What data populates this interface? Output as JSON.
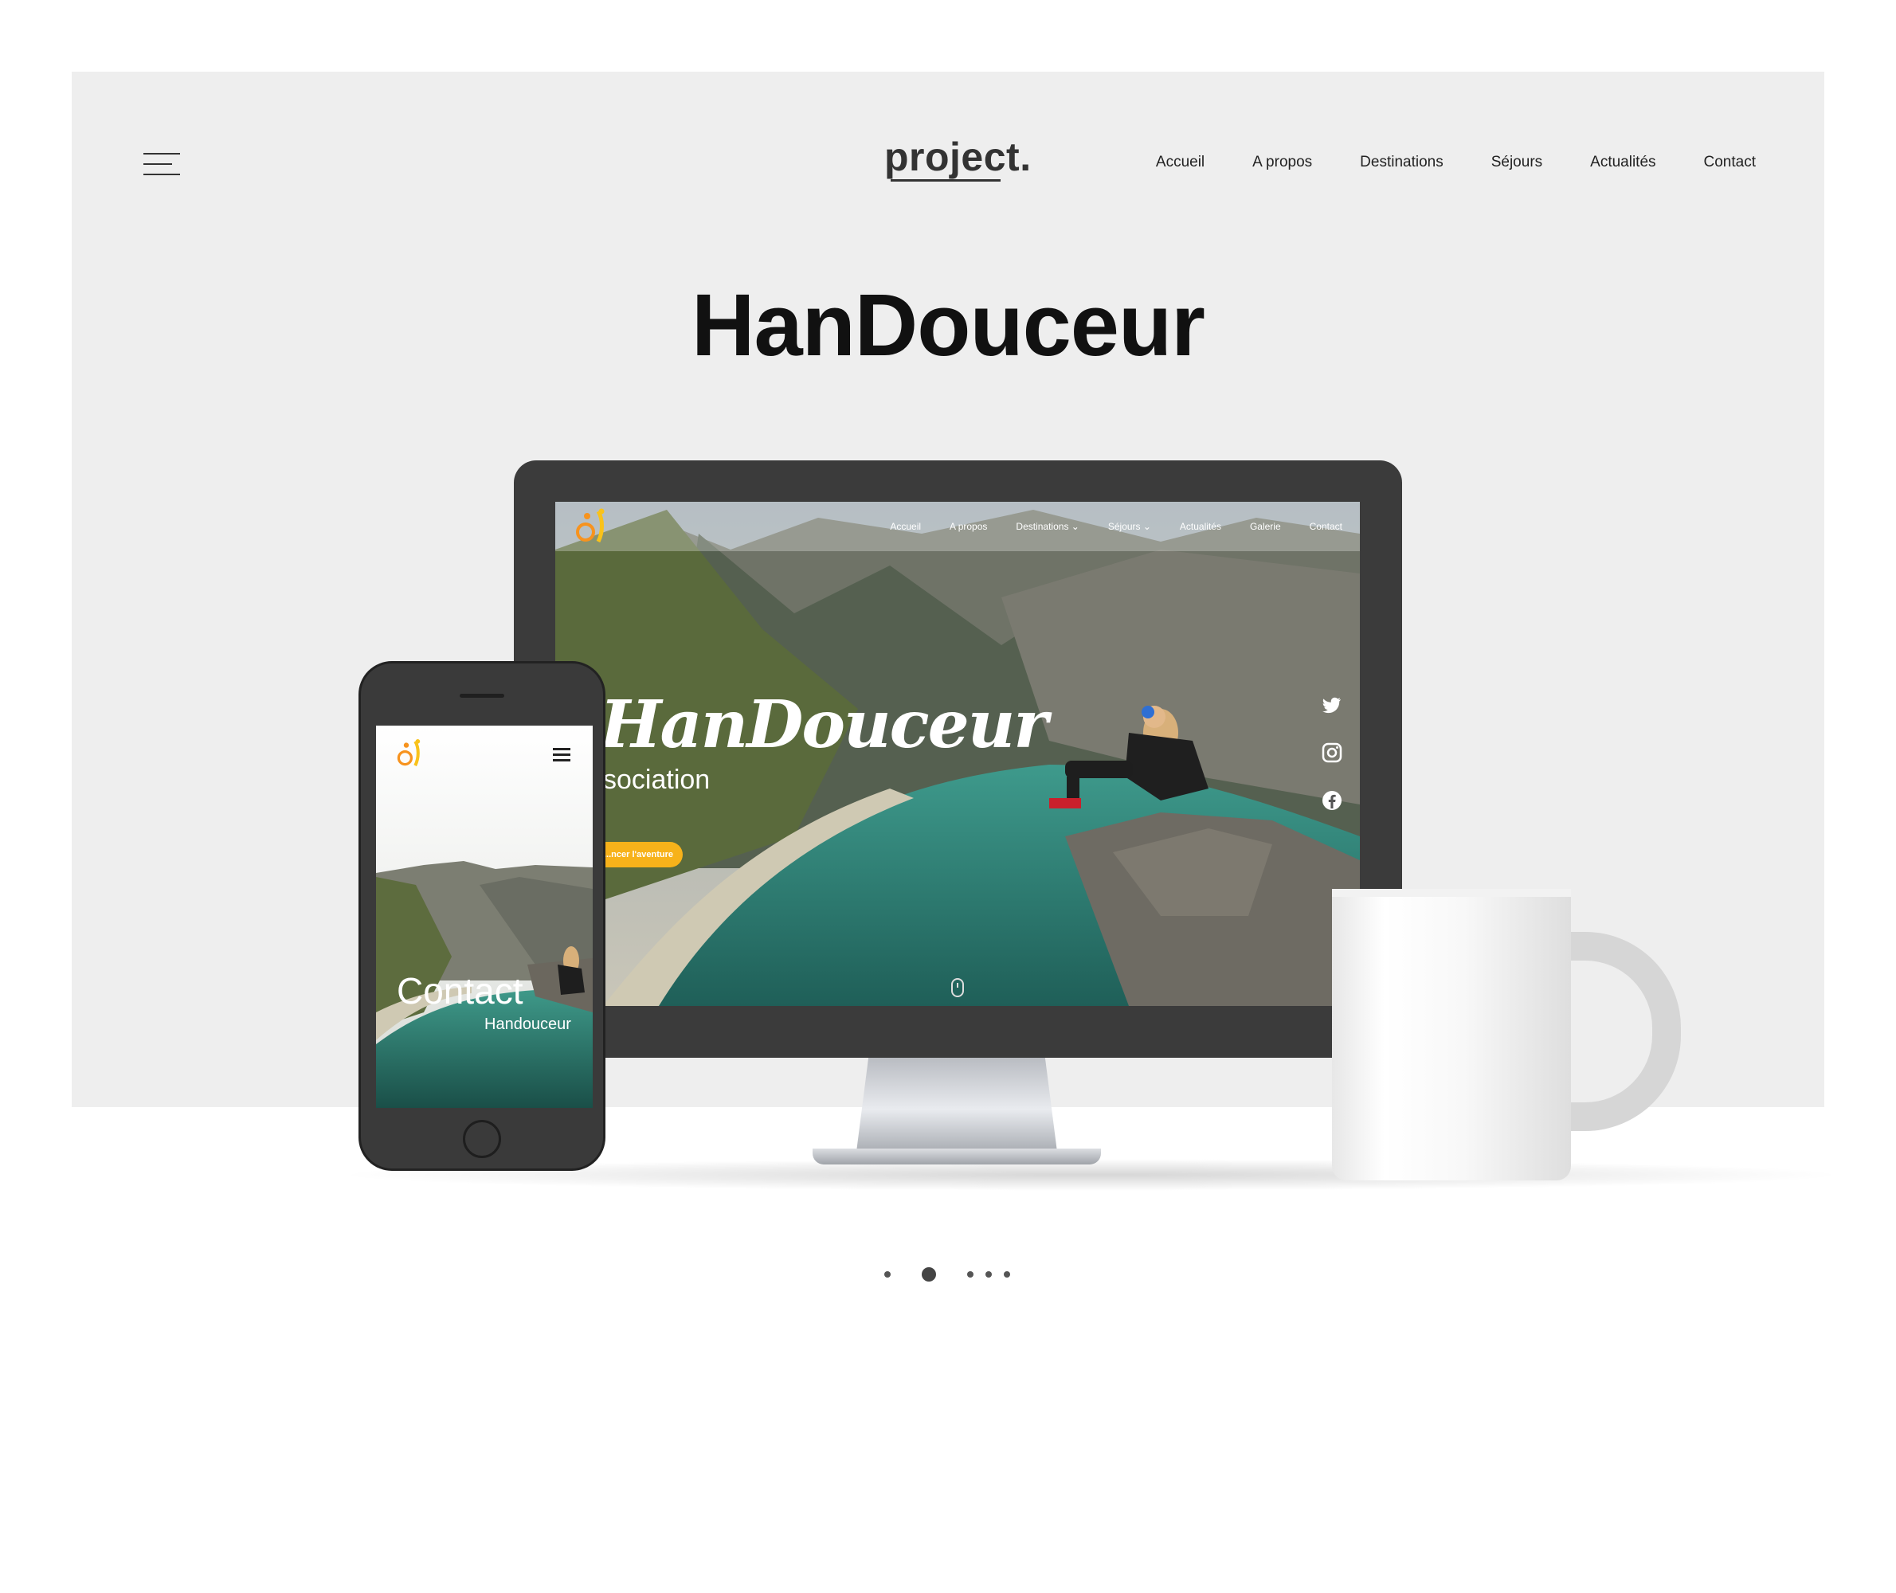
{
  "header": {
    "logo": "project.",
    "nav": [
      "Accueil",
      "A propos",
      "Destinations",
      "Séjours",
      "Actualités",
      "Contact"
    ]
  },
  "title": "HanDouceur",
  "desktop_site": {
    "nav": [
      "Accueil",
      "A propos",
      "Destinations ⌄",
      "Séjours ⌄",
      "Actualités",
      "Galerie",
      "Contact"
    ],
    "hero_title": "HanDouceur",
    "hero_subtitle": "sociation",
    "cta": "...ncer l'aventure",
    "social_icons": [
      "twitter-icon",
      "instagram-icon",
      "facebook-icon"
    ]
  },
  "mobile_site": {
    "heading": "Contact",
    "subheading": "Handouceur"
  },
  "carousel": {
    "count": 5,
    "active": 1
  },
  "colors": {
    "panel": "#eeeeee",
    "accent": "#f7b21a",
    "device": "#3b3b3b"
  }
}
